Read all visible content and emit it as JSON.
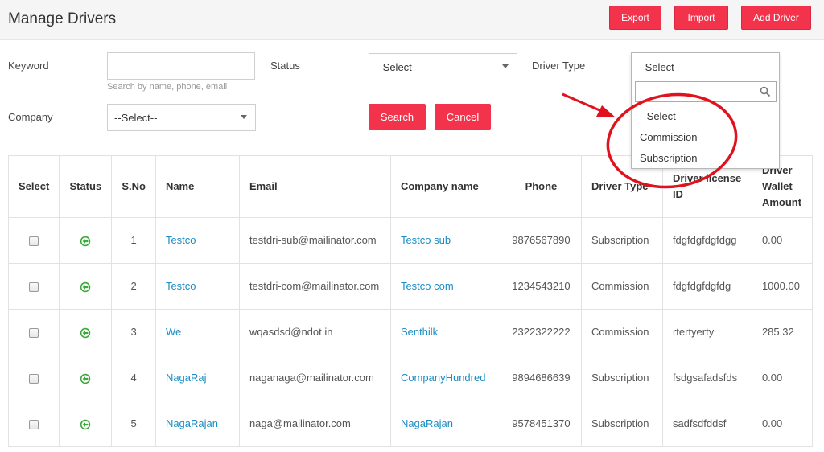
{
  "header": {
    "title": "Manage Drivers",
    "export_label": "Export",
    "import_label": "Import",
    "add_driver_label": "Add Driver"
  },
  "filters": {
    "keyword_label": "Keyword",
    "keyword_value": "",
    "keyword_hint": "Search by name, phone, email",
    "status_label": "Status",
    "status_value": "--Select--",
    "driver_type_label": "Driver Type",
    "driver_type_value": "--Select--",
    "company_label": "Company",
    "company_value": "--Select--",
    "search_label": "Search",
    "cancel_label": "Cancel"
  },
  "driver_type_dropdown": {
    "search_value": "",
    "options": [
      "--Select--",
      "Commission",
      "Subscription"
    ]
  },
  "table": {
    "headers": [
      "Select",
      "Status",
      "S.No",
      "Name",
      "Email",
      "Company name",
      "Phone",
      "Driver Type",
      "Driver license ID",
      "Driver Wallet Amount"
    ],
    "rows": [
      {
        "sno": "1",
        "name": "Testco",
        "email": "testdri-sub@mailinator.com",
        "company": "Testco sub",
        "phone": "9876567890",
        "type": "Subscription",
        "license": "fdgfdgfdgfdgg",
        "wallet": "0.00"
      },
      {
        "sno": "2",
        "name": "Testco",
        "email": "testdri-com@mailinator.com",
        "company": "Testco com",
        "phone": "1234543210",
        "type": "Commission",
        "license": "fdgfdgfdgfdg",
        "wallet": "1000.00"
      },
      {
        "sno": "3",
        "name": "We",
        "email": "wqasdsd@ndot.in",
        "company": "Senthilk",
        "phone": "2322322222",
        "type": "Commission",
        "license": "rtertyerty",
        "wallet": "285.32"
      },
      {
        "sno": "4",
        "name": "NagaRaj",
        "email": "naganaga@mailinator.com",
        "company": "CompanyHundred",
        "phone": "9894686639",
        "type": "Subscription",
        "license": "fsdgsafadsfds",
        "wallet": "0.00"
      },
      {
        "sno": "5",
        "name": "NagaRajan",
        "email": "naga@mailinator.com",
        "company": "NagaRajan",
        "phone": "9578451370",
        "type": "Subscription",
        "license": "sadfsdfddsf",
        "wallet": "0.00"
      }
    ]
  },
  "colors": {
    "accent": "#f2334b",
    "link": "#1b8cc4",
    "status_active": "#3aa83a",
    "annotation": "#e0121e"
  },
  "icons": {
    "status": "active-arrow-icon",
    "dropdown_search": "search-icon",
    "select_caret": "caret-down-icon"
  }
}
